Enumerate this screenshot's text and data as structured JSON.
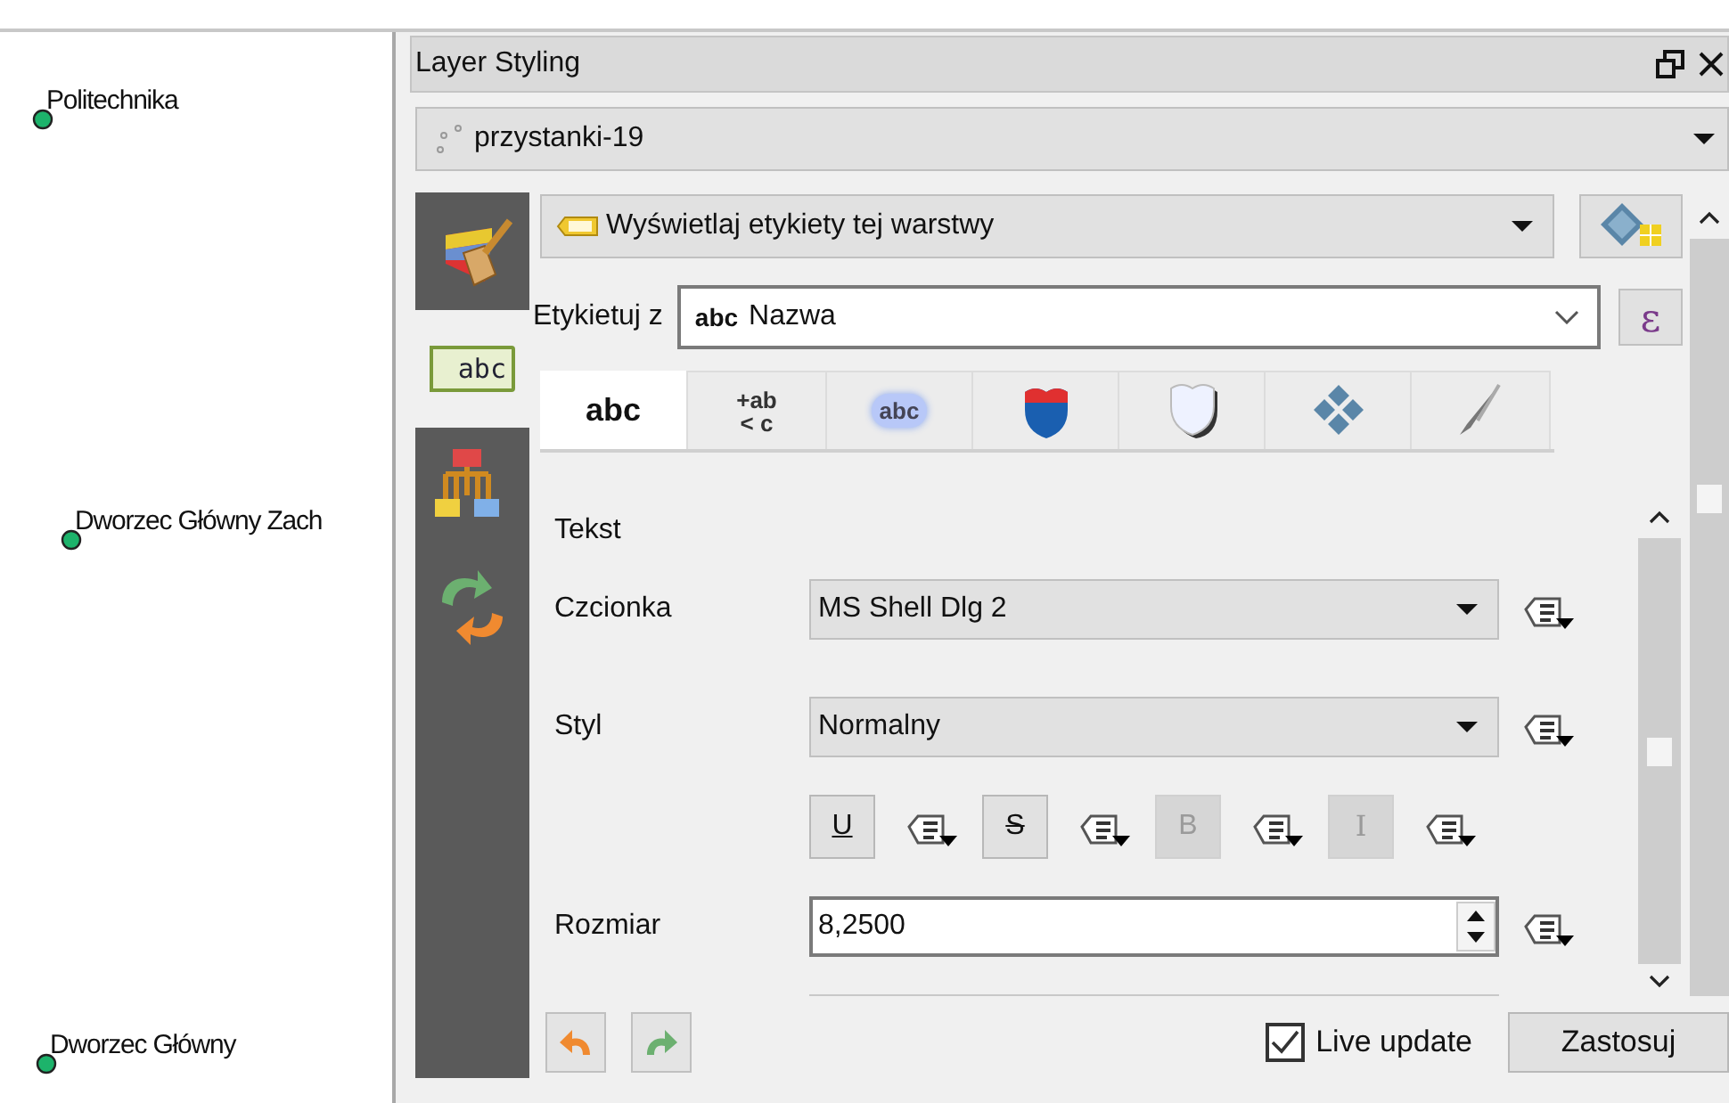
{
  "map": {
    "points": [
      {
        "label": "Politechnika"
      },
      {
        "label": "Dworzec Główny Zach"
      },
      {
        "label": "Dworzec Główny"
      }
    ]
  },
  "panel": {
    "title": "Layer Styling",
    "layer": "przystanki-19",
    "sidebar": [
      {
        "kind": "symbology",
        "selected": false
      },
      {
        "kind": "labels",
        "selected": true,
        "text": "abc"
      },
      {
        "kind": "diagrams",
        "selected": false
      },
      {
        "kind": "history",
        "selected": false
      }
    ],
    "label_mode": "Wyświetlaj etykiety tej warstwy",
    "label_with": {
      "label": "Etykietuj z",
      "prefix": "abc",
      "value": "Nazwa",
      "expression_button": "ε"
    },
    "tabs": [
      {
        "kind": "text",
        "label": "abc",
        "selected": true
      },
      {
        "kind": "formatting",
        "lines": [
          "+ab",
          "< c"
        ],
        "selected": false
      },
      {
        "kind": "buffer",
        "label": "abc",
        "selected": false
      },
      {
        "kind": "background",
        "selected": false
      },
      {
        "kind": "shadow",
        "selected": false
      },
      {
        "kind": "placement",
        "selected": false
      },
      {
        "kind": "rendering",
        "selected": false
      }
    ],
    "section": "Tekst",
    "rows": [
      {
        "kind": "combo",
        "label": "Czcionka",
        "value": "MS Shell Dlg 2"
      },
      {
        "kind": "combo",
        "label": "Styl",
        "value": "Normalny"
      },
      {
        "kind": "format_buttons",
        "buttons": [
          {
            "kind": "underline",
            "label": "U",
            "disabled": false
          },
          {
            "kind": "strike",
            "label": "S",
            "disabled": false
          },
          {
            "kind": "bold",
            "label": "B",
            "disabled": true
          },
          {
            "kind": "italic",
            "label": "I",
            "disabled": true
          }
        ]
      },
      {
        "kind": "spin",
        "label": "Rozmiar",
        "value": "8,2500"
      }
    ],
    "live_update": {
      "label": "Live update",
      "checked": true
    },
    "apply": "Zastosuj"
  }
}
